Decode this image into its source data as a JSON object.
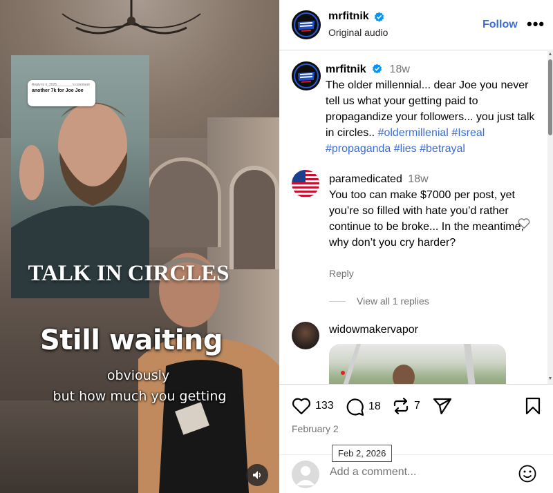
{
  "video": {
    "bubble_reply_to": "Reply to k_2025________'s comment",
    "bubble_text": "another 7k for Joe Joe",
    "inset_caption": "TALK IN CIRCLES",
    "overlay_title": "Still waiting",
    "overlay_line1": "obviously",
    "overlay_line2": "but how much you getting"
  },
  "header": {
    "username": "mrfitnik",
    "audio": "Original audio",
    "follow_label": "Follow",
    "more_label": "•••"
  },
  "caption": {
    "username": "mrfitnik",
    "time": "18w",
    "text": "The older millennial... dear Joe you never tell us what your getting paid to propagandize your followers... you just talk in circles..",
    "hashtags": [
      "#oldermillenial",
      "#Isreal",
      "#propaganda",
      "#lies",
      "#betrayal"
    ]
  },
  "comments": [
    {
      "username": "paramedicated",
      "time": "18w",
      "text": "You too can make $7000 per post, yet you’re so filled with hate you’d rather continue to be broke... In the meantime, why don’t you cry harder?",
      "reply_label": "Reply",
      "view_replies": "View all 1 replies"
    },
    {
      "username": "widowmakervapor"
    }
  ],
  "actions": {
    "likes": "133",
    "comments": "18",
    "reposts": "7",
    "date": "February 2",
    "tooltip": "Feb 2, 2026"
  },
  "add_comment": {
    "placeholder": "Add a comment..."
  },
  "colors": {
    "link_blue": "#3b6dd7",
    "verified_blue": "#0095f6",
    "muted_text": "#737373"
  }
}
